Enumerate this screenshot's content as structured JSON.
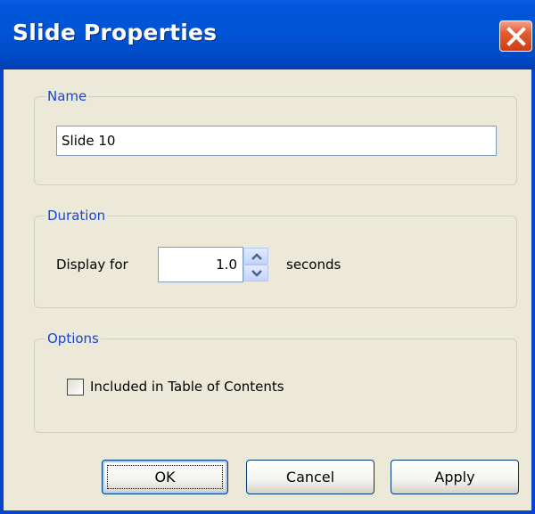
{
  "window": {
    "title": "Slide Properties",
    "titlebar_color": "#0054d6",
    "close_button_color": "#d03c14"
  },
  "name_group": {
    "legend": "Name",
    "value": "Slide 10"
  },
  "duration_group": {
    "legend": "Duration",
    "display_for_label": "Display for",
    "value": "1.0",
    "unit_label": "seconds"
  },
  "options_group": {
    "legend": "Options",
    "toc_checkbox_label": "Included in Table of Contents",
    "toc_checked": false
  },
  "buttons": {
    "ok": "OK",
    "cancel": "Cancel",
    "apply": "Apply"
  },
  "icons": {
    "close": "close-icon",
    "spin_up": "chevron-up-icon",
    "spin_down": "chevron-down-icon"
  }
}
